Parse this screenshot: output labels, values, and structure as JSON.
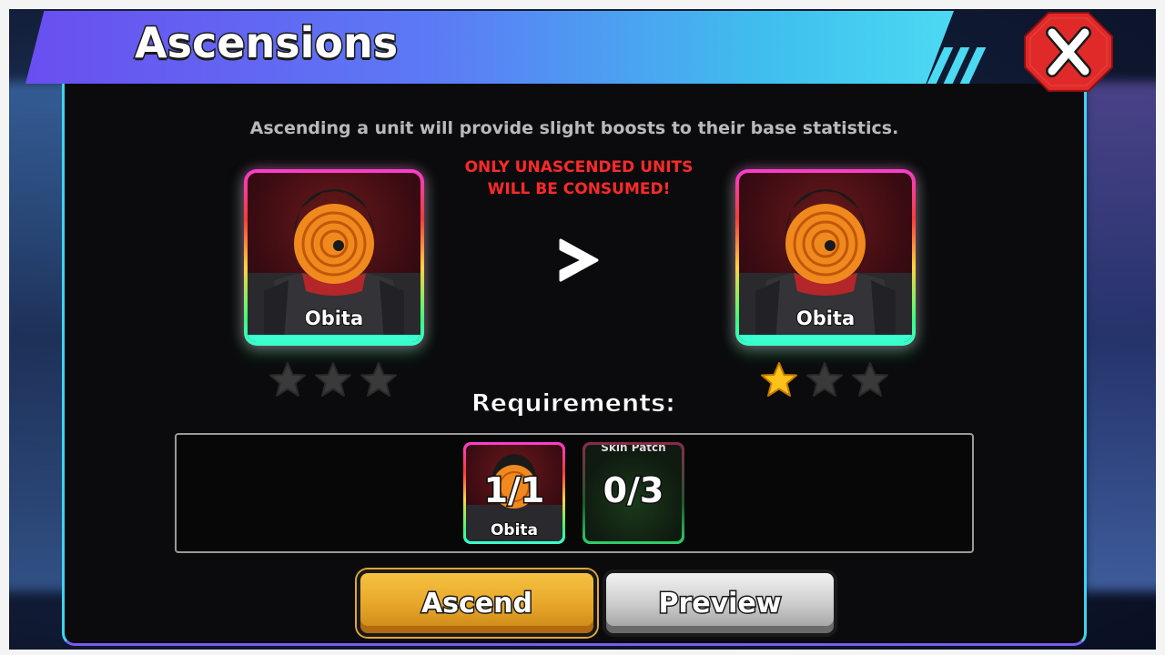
{
  "header": {
    "title": "Ascensions",
    "close_icon": "close-x-icon"
  },
  "colors": {
    "header_gradient_start": "#6a4ef0",
    "header_gradient_end": "#4cd9f2",
    "close_button": "#e02a2a",
    "warning_text": "#ff2a2a",
    "ascend_button": "#e8a82a",
    "preview_button": "#c9c9c9",
    "star_filled": "#ffc21a",
    "star_empty": "#3a3a3a"
  },
  "main": {
    "description": "Ascending a unit will provide slight boosts to their base statistics.",
    "warning_line1": "ONLY UNASCENDED UNITS",
    "warning_line2": "WILL BE CONSUMED!",
    "arrow_icon": "chevron-right-icon",
    "current_unit": {
      "name": "Obita",
      "stars_filled": 0,
      "stars_total": 3
    },
    "next_unit": {
      "name": "Obita",
      "stars_filled": 1,
      "stars_total": 3
    }
  },
  "requirements": {
    "title": "Requirements:",
    "items": [
      {
        "name": "Obita",
        "count": "1/1"
      },
      {
        "label": "Skin Patch",
        "count": "0/3"
      }
    ]
  },
  "actions": {
    "ascend_label": "Ascend",
    "preview_label": "Preview"
  }
}
